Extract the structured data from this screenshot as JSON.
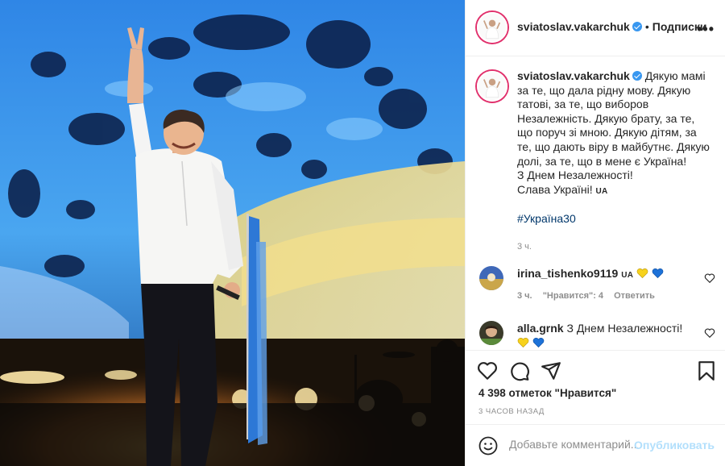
{
  "post": {
    "username": "sviatoslav.vakarchuk",
    "follow_label": "Подписки",
    "more_label": "•••",
    "caption_lines": [
      "Дякую мамі",
      "за те, що дала рідну мову. Дякую",
      "татові, за те, що виборов",
      "Незалежність. Дякую брату, за те,",
      "що поруч зі мною. Дякую дітям, за",
      "те, що дають віру в майбутнє. Дякую",
      "долі, за те, що в мене є Україна!",
      "З Днем Незалежності!",
      "Слава Україні!"
    ],
    "caption_flag": "UA",
    "hashtag": "#Україна30",
    "caption_time": "3 ч.",
    "likes": "4 398 отметок \"Нравится\"",
    "posted_ago": "3 ЧАСОВ НАЗАД"
  },
  "comments": [
    {
      "username": "irina_tishenko9119",
      "flag": "UA",
      "time": "3 ч.",
      "likes": "\"Нравится\": 4",
      "reply": "Ответить"
    },
    {
      "username": "alla.grnk",
      "text": "З Днем Незалежності!"
    }
  ],
  "composer": {
    "placeholder": "Добавьте комментарий...",
    "publish_label": "Опубликовать"
  },
  "icons": {
    "verified": "verified-badge-icon",
    "like": "heart-icon",
    "comment": "comment-icon",
    "share": "share-icon",
    "save": "bookmark-icon",
    "emoji": "smiley-icon"
  },
  "colors": {
    "verified": "#3897f0",
    "link": "#00376b",
    "muted": "#8e8e8e",
    "publish_disabled": "#b2dffc",
    "heart_yellow": "#f7d21c",
    "heart_blue": "#1d72d8"
  }
}
